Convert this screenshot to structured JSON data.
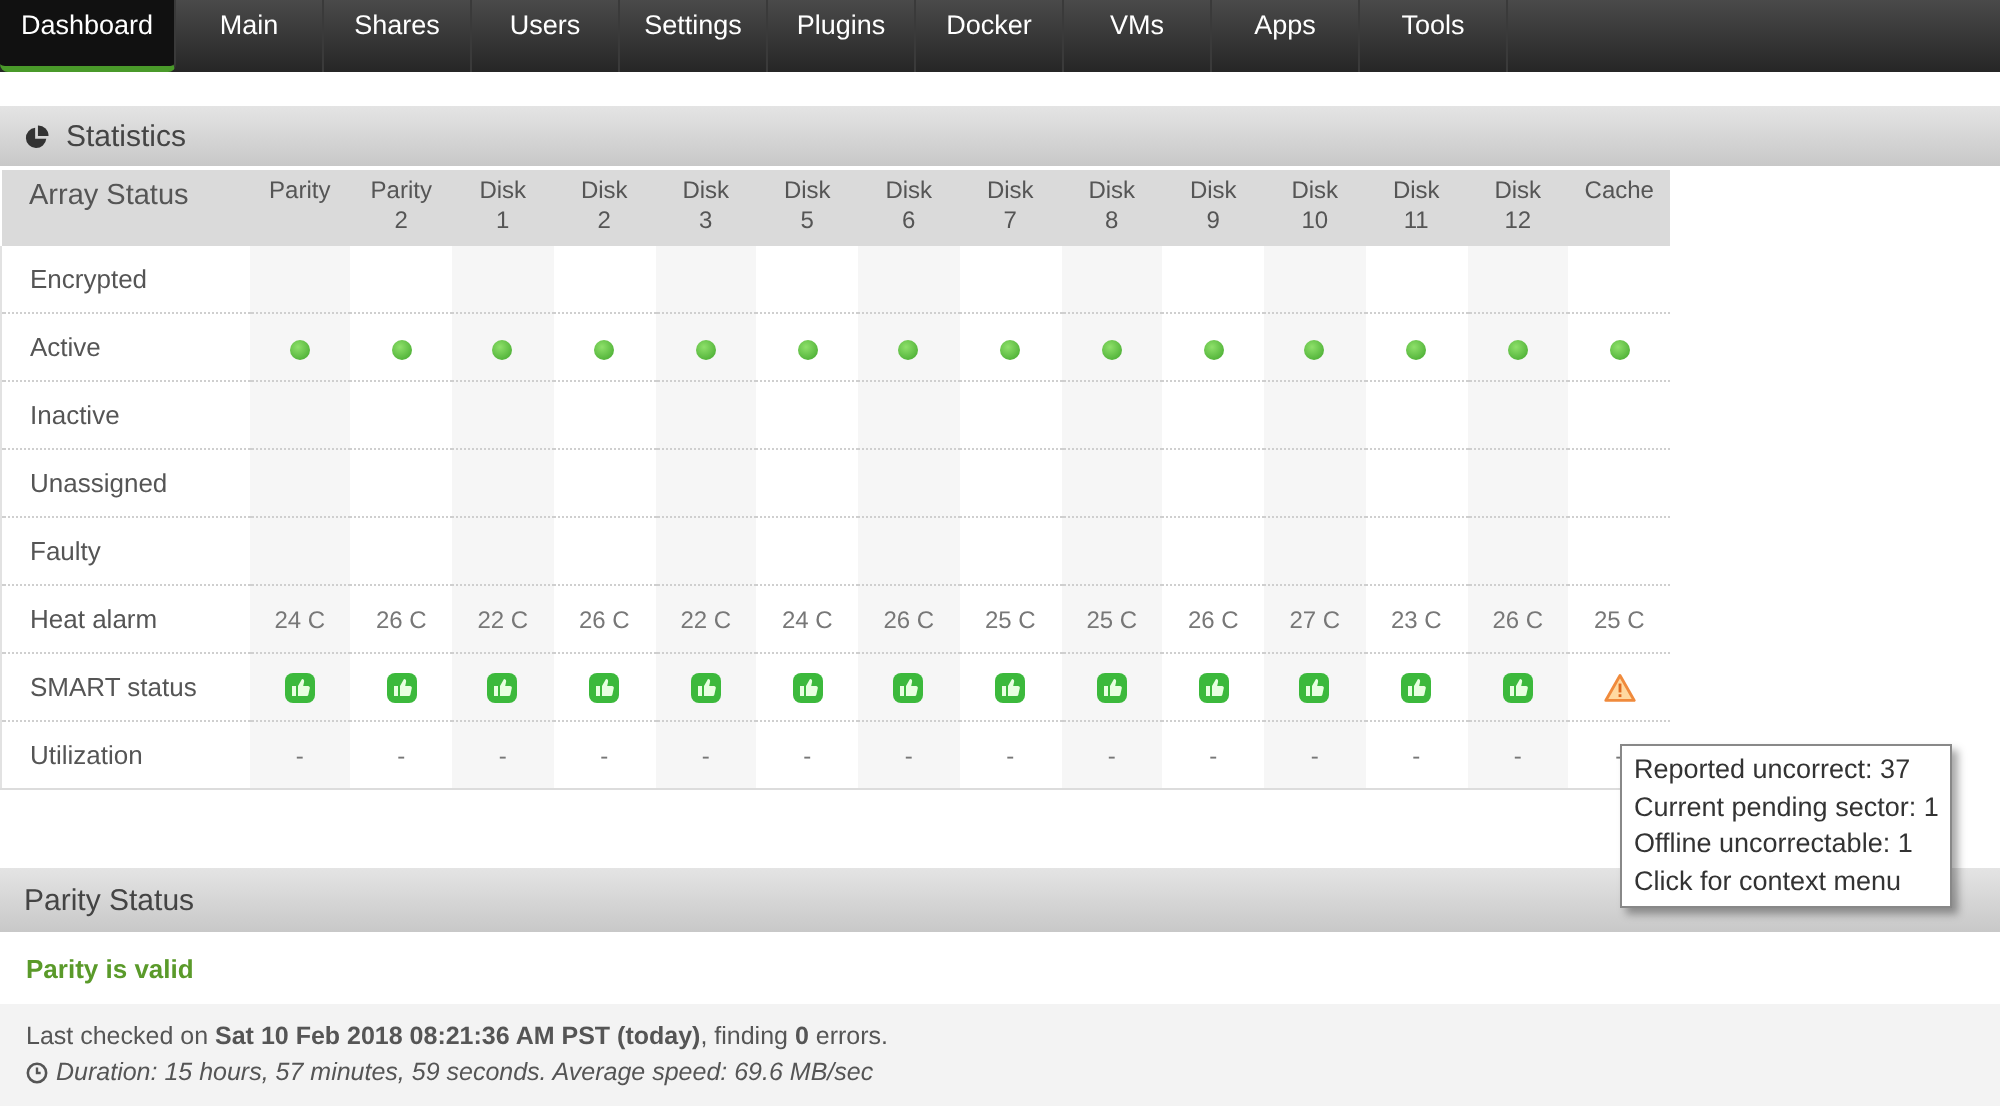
{
  "nav": [
    {
      "label": "Dashboard",
      "selected": true
    },
    {
      "label": "Main",
      "selected": false
    },
    {
      "label": "Shares",
      "selected": false
    },
    {
      "label": "Users",
      "selected": false
    },
    {
      "label": "Settings",
      "selected": false
    },
    {
      "label": "Plugins",
      "selected": false
    },
    {
      "label": "Docker",
      "selected": false
    },
    {
      "label": "VMs",
      "selected": false
    },
    {
      "label": "Apps",
      "selected": false
    },
    {
      "label": "Tools",
      "selected": false
    }
  ],
  "statistics": {
    "title": "Statistics",
    "corner": "Array Status",
    "rows": [
      {
        "label": "Encrypted",
        "kind": "encrypted"
      },
      {
        "label": "Active",
        "kind": "active"
      },
      {
        "label": "Inactive",
        "kind": "inactive"
      },
      {
        "label": "Unassigned",
        "kind": "unassigned"
      },
      {
        "label": "Faulty",
        "kind": "faulty"
      },
      {
        "label": "Heat alarm",
        "kind": "temp"
      },
      {
        "label": "SMART status",
        "kind": "smart"
      },
      {
        "label": "Utilization",
        "kind": "utilization"
      }
    ],
    "disks": [
      {
        "name": "Parity",
        "active": true,
        "temp": "24 C",
        "smart_ok": true,
        "utilization": "-"
      },
      {
        "name": "Parity",
        "number": "2",
        "active": true,
        "temp": "26 C",
        "smart_ok": true,
        "utilization": "-"
      },
      {
        "name": "Disk",
        "number": "1",
        "active": true,
        "temp": "22 C",
        "smart_ok": true,
        "utilization": "-"
      },
      {
        "name": "Disk",
        "number": "2",
        "active": true,
        "temp": "26 C",
        "smart_ok": true,
        "utilization": "-"
      },
      {
        "name": "Disk",
        "number": "3",
        "active": true,
        "temp": "22 C",
        "smart_ok": true,
        "utilization": "-"
      },
      {
        "name": "Disk",
        "number": "5",
        "active": true,
        "temp": "24 C",
        "smart_ok": true,
        "utilization": "-"
      },
      {
        "name": "Disk",
        "number": "6",
        "active": true,
        "temp": "26 C",
        "smart_ok": true,
        "utilization": "-"
      },
      {
        "name": "Disk",
        "number": "7",
        "active": true,
        "temp": "25 C",
        "smart_ok": true,
        "utilization": "-"
      },
      {
        "name": "Disk",
        "number": "8",
        "active": true,
        "temp": "25 C",
        "smart_ok": true,
        "utilization": "-"
      },
      {
        "name": "Disk",
        "number": "9",
        "active": true,
        "temp": "26 C",
        "smart_ok": true,
        "utilization": "-"
      },
      {
        "name": "Disk",
        "number": "10",
        "active": true,
        "temp": "27 C",
        "smart_ok": true,
        "utilization": "-"
      },
      {
        "name": "Disk",
        "number": "11",
        "active": true,
        "temp": "23 C",
        "smart_ok": true,
        "utilization": "-"
      },
      {
        "name": "Disk",
        "number": "12",
        "active": true,
        "temp": "26 C",
        "smart_ok": true,
        "utilization": "-"
      },
      {
        "name": "Cache",
        "active": true,
        "temp": "25 C",
        "smart_ok": false,
        "utilization": "-"
      }
    ]
  },
  "tooltip": {
    "lines": [
      "Reported uncorrect: 37",
      "Current pending sector: 1",
      "Offline uncorrectable: 1",
      "Click for context menu"
    ]
  },
  "parity": {
    "title": "Parity Status",
    "status": "Parity is valid",
    "last_checked": "Last checked on **Sat 10 Feb 2018 08:21:36 AM PST (today)**, finding **0** errors.",
    "duration": "Duration: 15 hours, 57 minutes, 59 seconds. Average speed: 69.6 MB/sec"
  }
}
